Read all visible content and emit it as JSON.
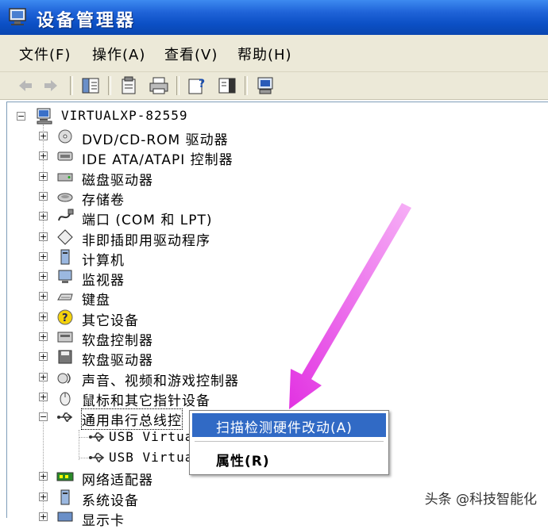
{
  "window": {
    "title": "设备管理器"
  },
  "menu": [
    {
      "label": "文件(F)"
    },
    {
      "label": "操作(A)"
    },
    {
      "label": "查看(V)"
    },
    {
      "label": "帮助(H)"
    }
  ],
  "tree": {
    "root": "VIRTUALXP-82559",
    "items": [
      {
        "label": "DVD/CD-ROM 驱动器",
        "icon": "cdrom-icon"
      },
      {
        "label": "IDE ATA/ATAPI 控制器",
        "icon": "ide-controller-icon"
      },
      {
        "label": "磁盘驱动器",
        "icon": "disk-drive-icon"
      },
      {
        "label": "存储卷",
        "icon": "storage-volume-icon"
      },
      {
        "label": "端口 (COM 和 LPT)",
        "icon": "port-icon"
      },
      {
        "label": "非即插即用驱动程序",
        "icon": "non-pnp-driver-icon"
      },
      {
        "label": "计算机",
        "icon": "computer-icon"
      },
      {
        "label": "监视器",
        "icon": "monitor-icon"
      },
      {
        "label": "键盘",
        "icon": "keyboard-icon"
      },
      {
        "label": "其它设备",
        "icon": "other-device-icon"
      },
      {
        "label": "软盘控制器",
        "icon": "floppy-controller-icon"
      },
      {
        "label": "软盘驱动器",
        "icon": "floppy-drive-icon"
      },
      {
        "label": "声音、视频和游戏控制器",
        "icon": "sound-icon"
      },
      {
        "label": "鼠标和其它指针设备",
        "icon": "mouse-icon"
      },
      {
        "label": "通用串行总线控",
        "icon": "usb-icon"
      }
    ],
    "usb_children": [
      {
        "label": "USB Virtual"
      },
      {
        "label": "USB Virtual"
      }
    ],
    "after": [
      {
        "label": "网络适配器",
        "icon": "network-adapter-icon"
      },
      {
        "label": "系统设备",
        "icon": "system-device-icon"
      },
      {
        "label": "显示卡",
        "icon": "display-adapter-icon"
      }
    ]
  },
  "context_menu": {
    "scan": "扫描检测硬件改动(A)",
    "properties": "属性(R)"
  },
  "watermark": "头条 @科技智能化",
  "colors": {
    "highlight": "#316ac5",
    "arrow": "#e040e0",
    "titlebar": "#0b4fc4"
  }
}
